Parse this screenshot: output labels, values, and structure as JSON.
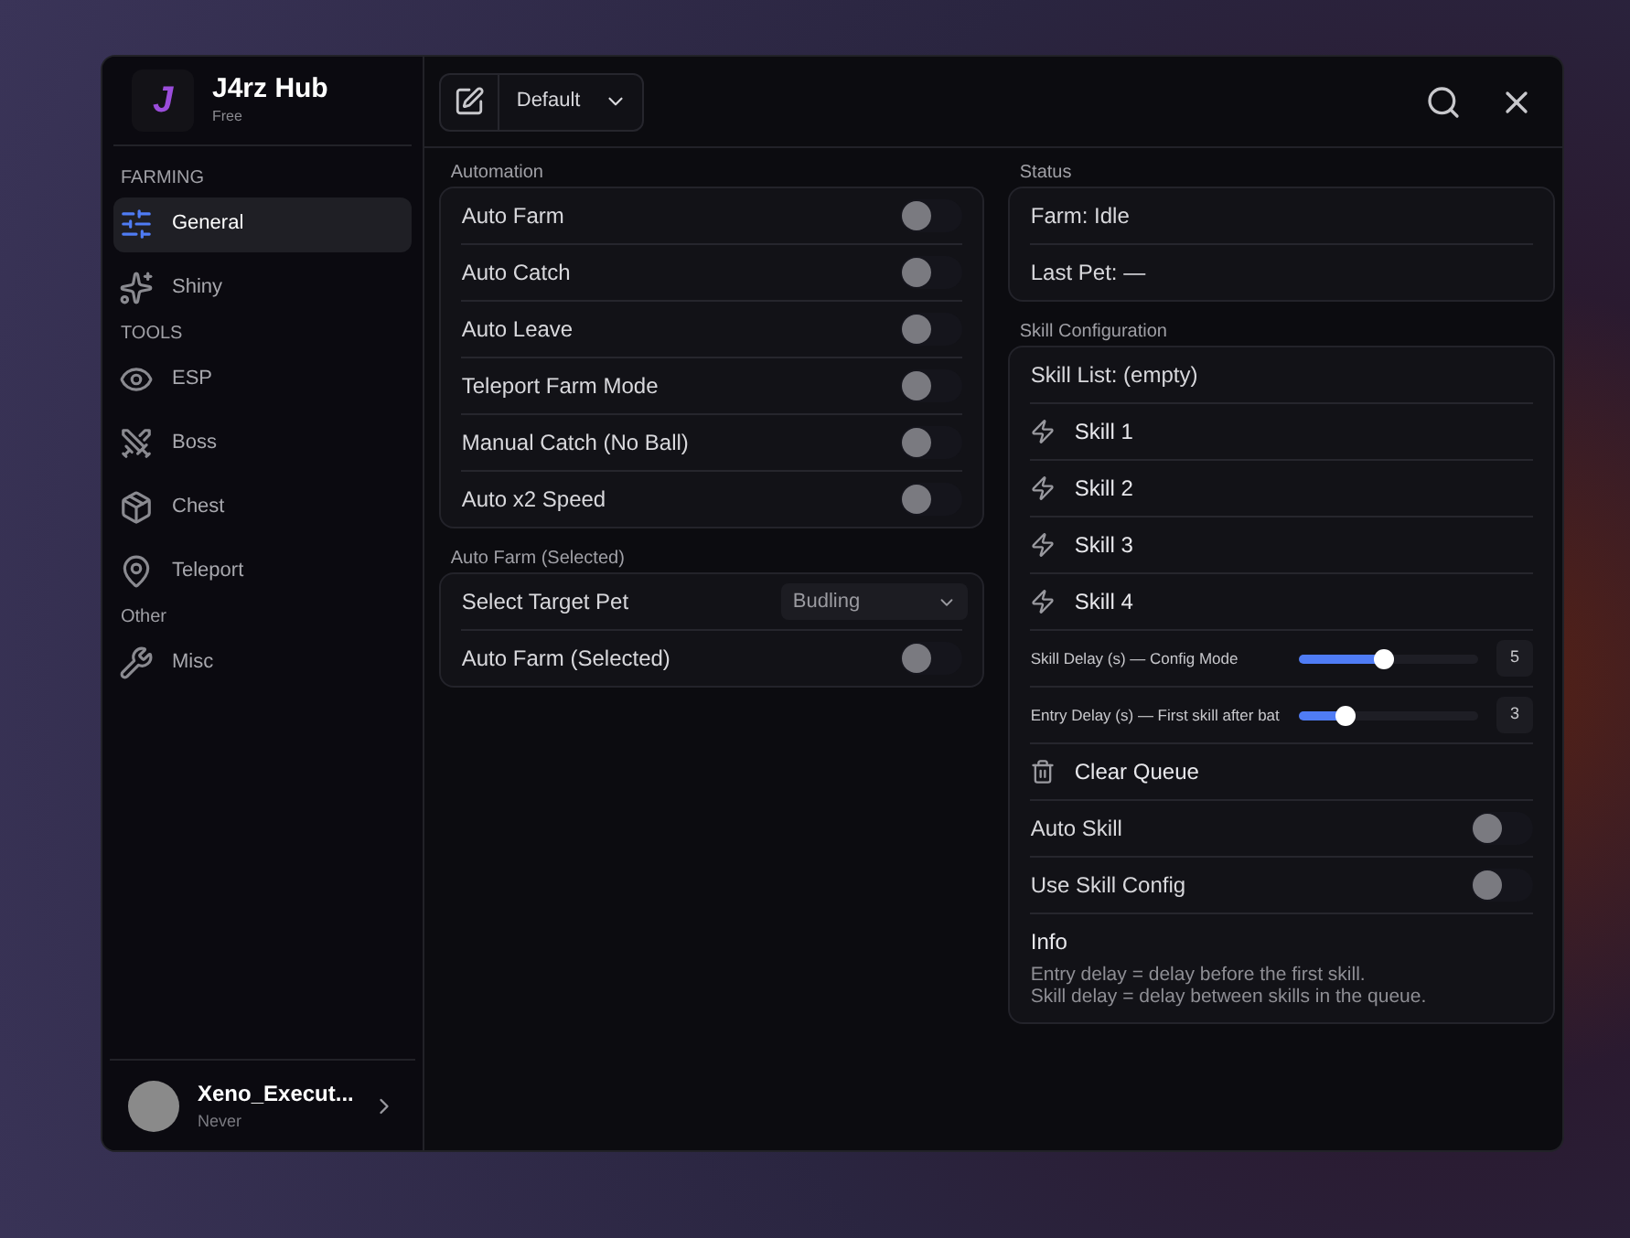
{
  "app": {
    "title": "J4rz Hub",
    "subtitle": "Free",
    "logo": "J"
  },
  "sidebar": {
    "sections": [
      {
        "title": "FARMING",
        "items": [
          {
            "label": "General",
            "kind": "sliders",
            "selected": true
          },
          {
            "label": "Shiny",
            "kind": "sparkles",
            "selected": false
          }
        ]
      },
      {
        "title": "TOOLS",
        "items": [
          {
            "label": "ESP",
            "kind": "eye",
            "selected": false
          },
          {
            "label": "Boss",
            "kind": "swords",
            "selected": false
          },
          {
            "label": "Chest",
            "kind": "package",
            "selected": false
          },
          {
            "label": "Teleport",
            "kind": "pin",
            "selected": false
          }
        ]
      },
      {
        "title": "Other",
        "items": [
          {
            "label": "Misc",
            "kind": "wrench",
            "selected": false
          }
        ]
      }
    ]
  },
  "user": {
    "name": "Xeno_Execut...",
    "status": "Never"
  },
  "config_dropdown": {
    "value": "Default"
  },
  "left_column": [
    {
      "title": "Automation",
      "rows": [
        {
          "kind": "toggle",
          "label": "Auto Farm",
          "on": false
        },
        {
          "kind": "toggle",
          "label": "Auto Catch",
          "on": false
        },
        {
          "kind": "toggle",
          "label": "Auto Leave",
          "on": false
        },
        {
          "kind": "toggle",
          "label": "Teleport Farm Mode",
          "on": false
        },
        {
          "kind": "toggle",
          "label": "Manual Catch (No Ball)",
          "on": false
        },
        {
          "kind": "toggle",
          "label": "Auto x2 Speed",
          "on": false
        }
      ]
    },
    {
      "title": "Auto Farm (Selected)",
      "rows": [
        {
          "kind": "dropdown",
          "label": "Select Target Pet",
          "value": "Budling"
        },
        {
          "kind": "toggle",
          "label": "Auto Farm (Selected)",
          "on": false
        }
      ]
    }
  ],
  "right_column": [
    {
      "title": "Status",
      "rows": [
        {
          "kind": "text",
          "label": "Farm: Idle"
        },
        {
          "kind": "text",
          "label": "Last Pet: —"
        }
      ]
    },
    {
      "title": "Skill Configuration",
      "rows": [
        {
          "kind": "text",
          "label": "Skill List: (empty)"
        },
        {
          "kind": "skill",
          "label": "Skill 1"
        },
        {
          "kind": "skill",
          "label": "Skill 2"
        },
        {
          "kind": "skill",
          "label": "Skill 3"
        },
        {
          "kind": "skill",
          "label": "Skill 4"
        },
        {
          "kind": "slider",
          "label": "Skill Delay (s) — Config Mode",
          "level": 0.47,
          "reading": "5"
        },
        {
          "kind": "slider",
          "label": "Entry Delay (s) — First skill after bat",
          "level": 0.26,
          "reading": "3"
        },
        {
          "kind": "clear",
          "label": "Clear Queue"
        },
        {
          "kind": "toggle",
          "label": "Auto Skill",
          "on": false
        },
        {
          "kind": "toggle",
          "label": "Use Skill Config",
          "on": false
        },
        {
          "kind": "info",
          "label": "Info",
          "lines": [
            "Entry delay = delay before the first skill.",
            "Skill delay = delay between skills in the queue."
          ]
        }
      ]
    }
  ]
}
